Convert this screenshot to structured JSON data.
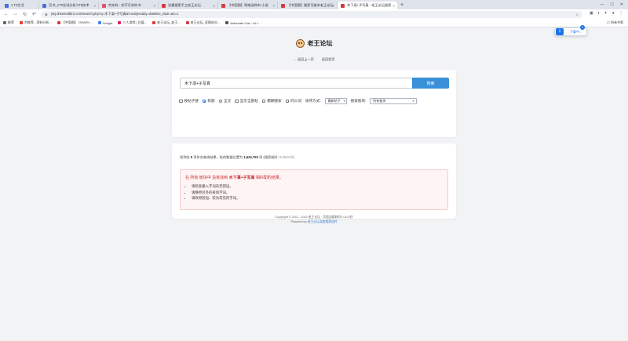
{
  "browser": {
    "tabs": [
      {
        "title": "1 T0生活",
        "color": "#4a6fd8",
        "active": false
      },
      {
        "title": "百书_1T0名词分析/1T0技术",
        "color": "#4a6fd8",
        "active": false
      },
      {
        "title": "京东科 - 你不可求的书",
        "color": "#e05263",
        "active": false
      },
      {
        "title": "流量搜索手工老王论坛",
        "color": "#d63b3b",
        "active": false
      },
      {
        "title": "【中国图】两难选择市·小说",
        "color": "#d63b3b",
        "active": false
      },
      {
        "title": "【中国图】搜索可能市老王论坛",
        "color": "#d63b3b",
        "active": false
      },
      {
        "title": "木下凛+子写真 - 老王论坛搜索",
        "color": "#d63b3b",
        "active": true
      }
    ],
    "new_tab": "+",
    "url": "jsnj.shkeeeldbr2.com/search.php?q=木下凛+子写真&f=subject&by=dateline_D&tr=&s=1",
    "bookmarks": [
      {
        "label": "推荐",
        "color": "#666"
      },
      {
        "label": "京推荐 - 资料分析...",
        "color": "#e53935"
      },
      {
        "label": "【中国图】 GRAPH...",
        "color": "#d63b3b"
      },
      {
        "label": "Google",
        "color": "#4285f4"
      },
      {
        "label": "三人游戏 | 比值...",
        "color": "#e91e63"
      },
      {
        "label": "老王论坛_老王...",
        "color": "#d63b3b"
      },
      {
        "label": "老王论坛_亚图站分...",
        "color": "#d63b3b"
      },
      {
        "label": "Automate Cad - AI L...",
        "color": "#555"
      }
    ],
    "bookmarks_right": "所有书签",
    "download_label": "下载中...",
    "download_count": "1"
  },
  "site": {
    "title": "老王论坛",
    "back_link": "← 返回上一页",
    "home_link": "返回首页"
  },
  "search": {
    "query": "木下凛+子写真",
    "button": "搜索",
    "options": [
      {
        "label": "按帖子搜",
        "kind": "checkbox",
        "checked": false
      },
      {
        "label": "标题",
        "kind": "radio",
        "checked": true
      },
      {
        "label": "全文",
        "kind": "radio",
        "checked": false
      },
      {
        "label": "显示全部帖",
        "kind": "checkbox",
        "checked": false
      },
      {
        "label": "模糊搜索",
        "kind": "checkbox",
        "checked": false
      },
      {
        "label": "同义词",
        "kind": "checkbox",
        "checked": false
      }
    ],
    "sort_label": "排序方式:",
    "sort_value": "最新帖子",
    "board_label": "搜索板块:",
    "board_value": "所有板块"
  },
  "results": {
    "stats_prefix": "找到帖",
    "count_found": "0",
    "stats_mid": "项符合查询结果，帖的数据位置为",
    "total": "1,624,793",
    "stats_suffix": "项 (搜索耗时:",
    "time": "0.0019 秒)",
    "notice_prefix": "在 所有 板块中 没有找到",
    "notice_keyword": "木下凛+子写真",
    "notice_suffix": "相匹配的结果。",
    "tips": [
      "请检查输入字词有无错误。",
      "请换用另外的查询字词。",
      "请改用较短、较为常见的字词。"
    ]
  },
  "footer": {
    "copyright": "Copyright © 2011 - 2023 老王论坛 · 页面加载耗时0.0102秒",
    "powered_prefix": "Powered by",
    "powered_link": "老王论坛深度搜索插件"
  }
}
